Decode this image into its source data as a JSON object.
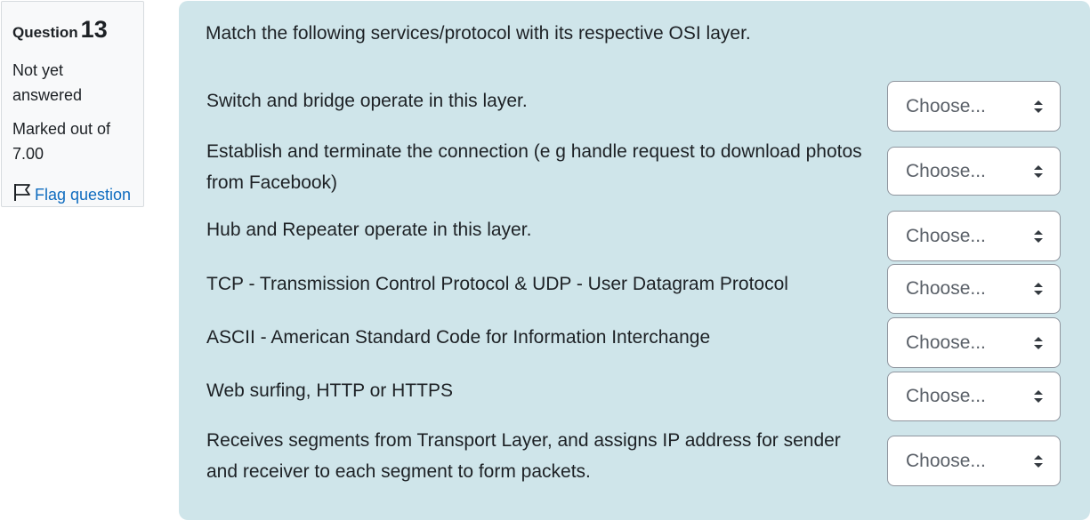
{
  "info": {
    "question_label": "Question",
    "question_number": "13",
    "state": "Not yet answered",
    "grade": "Marked out of 7.00",
    "flag_label": "Flag question"
  },
  "question": {
    "text": "Match the following services/protocol with its respective OSI layer.",
    "rows": [
      {
        "stem": "Switch and bridge operate in this layer.",
        "selected": "Choose..."
      },
      {
        "stem": "Establish and terminate the connection (e g handle request to download photos from Facebook)",
        "selected": "Choose..."
      },
      {
        "stem": "Hub and Repeater operate in this layer.",
        "selected": "Choose..."
      },
      {
        "stem": "TCP - Transmission Control Protocol & UDP - User Datagram Protocol",
        "selected": "Choose..."
      },
      {
        "stem": "ASCII - American Standard Code for Information Interchange",
        "selected": "Choose..."
      },
      {
        "stem": "Web surfing, HTTP or HTTPS",
        "selected": "Choose..."
      },
      {
        "stem": "Receives segments from Transport Layer, and assigns IP address for sender and receiver to each segment to form packets.",
        "selected": "Choose..."
      }
    ]
  },
  "colors": {
    "content_bg": "#cfe5ea",
    "link": "#0f6cbf",
    "info_bg": "#f8f9fa"
  },
  "icons": {
    "flag": "flag-icon",
    "select_arrows": "sort-arrows-icon"
  }
}
